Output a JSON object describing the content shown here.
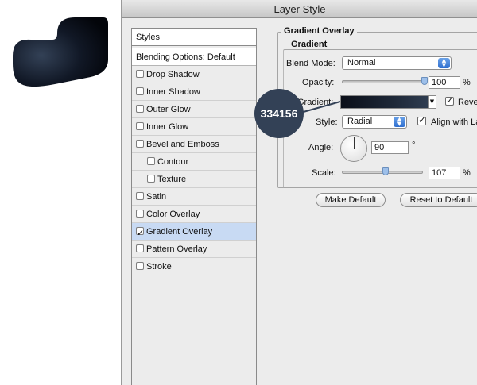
{
  "dialog": {
    "title": "Layer Style"
  },
  "styles_panel": {
    "header": "Styles",
    "blending": "Blending Options: Default",
    "items": [
      {
        "label": "Drop Shadow",
        "checked": false
      },
      {
        "label": "Inner Shadow",
        "checked": false
      },
      {
        "label": "Outer Glow",
        "checked": false
      },
      {
        "label": "Inner Glow",
        "checked": false
      },
      {
        "label": "Bevel and Emboss",
        "checked": false
      },
      {
        "label": "Contour",
        "checked": false
      },
      {
        "label": "Texture",
        "checked": false
      },
      {
        "label": "Satin",
        "checked": false
      },
      {
        "label": "Color Overlay",
        "checked": false
      },
      {
        "label": "Gradient Overlay",
        "checked": true
      },
      {
        "label": "Pattern Overlay",
        "checked": false
      },
      {
        "label": "Stroke",
        "checked": false
      }
    ]
  },
  "gradient_overlay": {
    "section_title": "Gradient Overlay",
    "group_title": "Gradient",
    "blend_mode_label": "Blend Mode:",
    "blend_mode_value": "Normal",
    "opacity_label": "Opacity:",
    "opacity_value": "100",
    "opacity_unit": "%",
    "opacity_level": 1.0,
    "gradient_label": "Gradient:",
    "reverse_label": "Reverse",
    "reverse_checked": true,
    "style_label": "Style:",
    "style_value": "Radial",
    "align_label": "Align with Layer",
    "align_checked": true,
    "angle_label": "Angle:",
    "angle_value": "90",
    "angle_unit": "°",
    "scale_label": "Scale:",
    "scale_value": "107",
    "scale_unit": "%",
    "scale_level": 0.535,
    "make_default": "Make Default",
    "reset_default": "Reset to Default"
  },
  "callout": {
    "text": "334156",
    "color": "#334156"
  },
  "colors": {
    "gradient_start": "#0a0e18",
    "gradient_end": "#334156",
    "selection": "#c8daf3",
    "accent": "#2f6fd0"
  }
}
